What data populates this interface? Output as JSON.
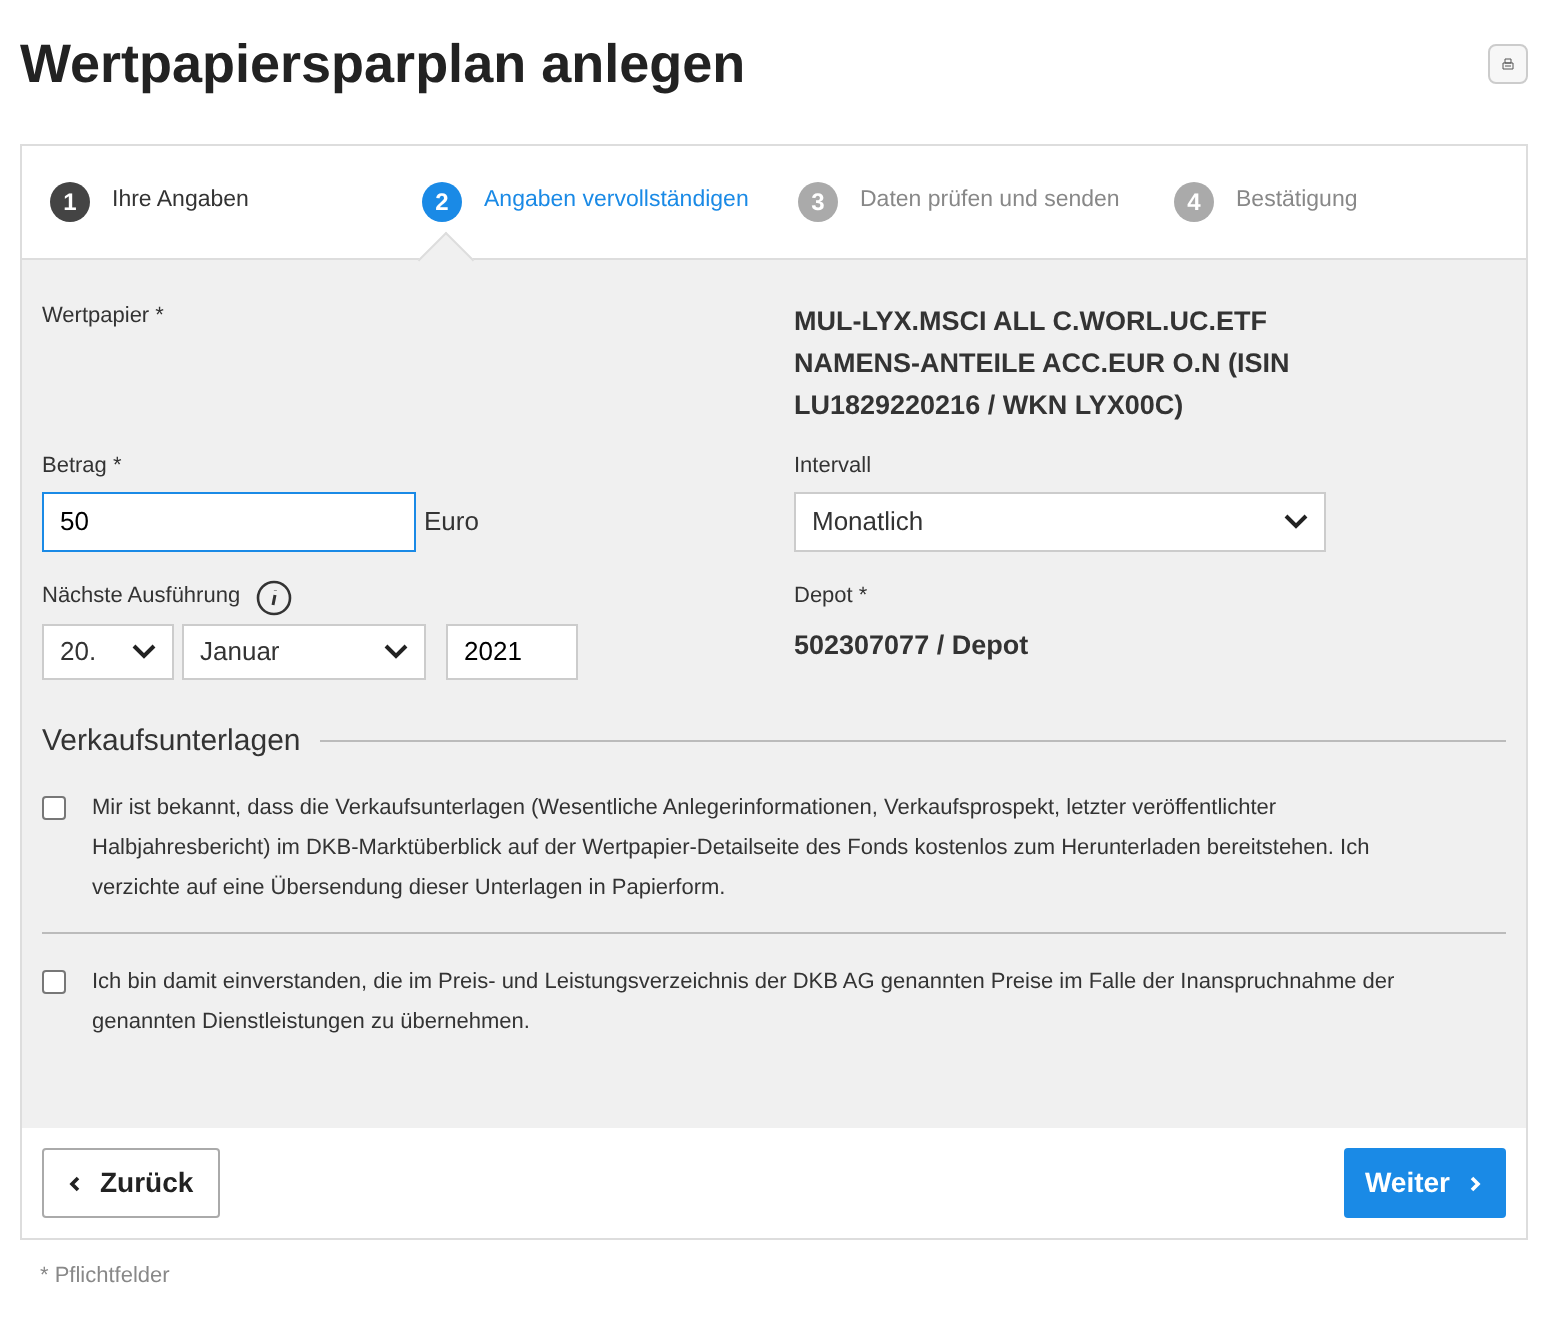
{
  "page": {
    "title": "Wertpapiersparplan anlegen"
  },
  "steps": [
    {
      "number": "1",
      "label": "Ihre Angaben",
      "completed": true,
      "selected": false
    },
    {
      "number": "2",
      "label": "Angaben vervollständigen",
      "completed": false,
      "selected": true
    },
    {
      "number": "3",
      "label": "Daten prüfen und senden",
      "completed": false,
      "selected": false
    },
    {
      "number": "4",
      "label": "Bestätigung",
      "completed": false,
      "selected": false
    }
  ],
  "form": {
    "security": {
      "label": "Wertpapier *",
      "value": "MUL-LYX.MSCI ALL C.WORL.UC.ETF NAMENS-ANTEILE ACC.EUR O.N (ISIN LU1829220216 / WKN LYX00C)"
    },
    "amount": {
      "label": "Betrag *",
      "value": "50",
      "unit": "Euro"
    },
    "interval": {
      "label": "Intervall",
      "value": "Monatlich"
    },
    "next_execution": {
      "label": "Nächste Ausführung",
      "day": "20.",
      "month": "Januar",
      "year": "2021"
    },
    "depot": {
      "label": "Depot *",
      "value": "502307077 / Depot"
    }
  },
  "documents": {
    "heading": "Verkaufsunterlagen",
    "consents": [
      {
        "text": "Mir ist bekannt, dass die Verkaufsunterlagen (Wesentliche Anlegerinformationen, Verkaufsprospekt, letzter veröffentlichter Halbjahresbericht) im DKB-Marktüberblick auf der Wertpapier-Detailseite des Fonds kostenlos zum Herunterladen bereitstehen. Ich verzichte auf eine Übersendung dieser Unterlagen in Papierform.",
        "checked": false
      },
      {
        "text": "Ich bin damit einverstanden, die im Preis- und Leistungsverzeichnis der DKB AG genannten Preise im Falle der Inanspruchnahme der genannten Dienstleistungen zu übernehmen.",
        "checked": false
      }
    ]
  },
  "buttons": {
    "back": "Zurück",
    "next": "Weiter"
  },
  "footnote": "* Pflichtfelder"
}
